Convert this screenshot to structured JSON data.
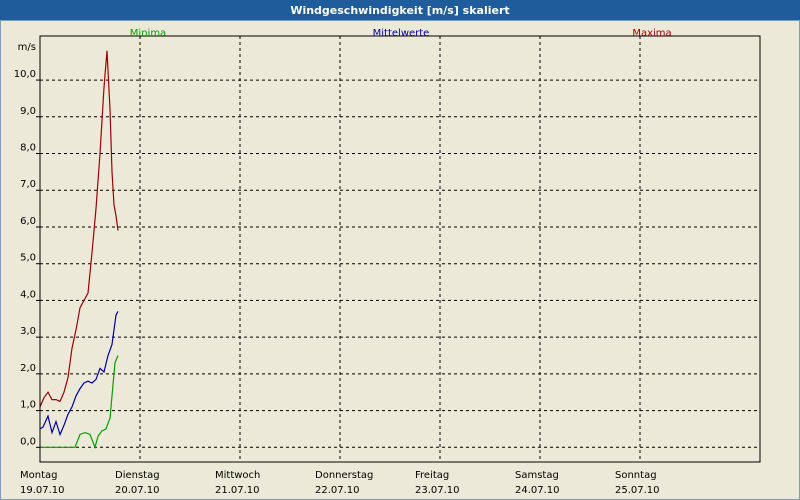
{
  "window": {
    "title": "Windgeschwindigkeit [m/s] skaliert"
  },
  "colors": {
    "minima": "#00A000",
    "mittelwerte": "#0000A0",
    "maxima": "#A00000",
    "titlebar": "#1F5C9C"
  },
  "chart_data": {
    "type": "line",
    "ylabel": "m/s",
    "ylim": [
      -0.4,
      11.2
    ],
    "yticks": [
      "0,0",
      "1,0",
      "2,0",
      "3,0",
      "4,0",
      "5,0",
      "6,0",
      "7,0",
      "8,0",
      "9,0",
      "10,0"
    ],
    "yticks_values": [
      0,
      1,
      2,
      3,
      4,
      5,
      6,
      7,
      8,
      9,
      10
    ],
    "xlim": [
      0,
      7.2
    ],
    "xticks": [
      {
        "day": "Montag",
        "date": "19.07.10"
      },
      {
        "day": "Dienstag",
        "date": "20.07.10"
      },
      {
        "day": "Mittwoch",
        "date": "21.07.10"
      },
      {
        "day": "Donnerstag",
        "date": "22.07.10"
      },
      {
        "day": "Freitag",
        "date": "23.07.10"
      },
      {
        "day": "Samstag",
        "date": "24.07.10"
      },
      {
        "day": "Sonntag",
        "date": "25.07.10"
      }
    ],
    "grid": true,
    "series": [
      {
        "name": "Minima",
        "color": "#00A000",
        "x": [
          0,
          0.05,
          0.1,
          0.15,
          0.2,
          0.25,
          0.3,
          0.35,
          0.4,
          0.45,
          0.5,
          0.55,
          0.58,
          0.62,
          0.66,
          0.7,
          0.75,
          0.78
        ],
        "y": [
          0.0,
          0.0,
          0.0,
          0.0,
          0.0,
          0.0,
          0.0,
          0.0,
          0.35,
          0.4,
          0.35,
          0.0,
          0.3,
          0.45,
          0.5,
          0.8,
          2.3,
          2.5
        ]
      },
      {
        "name": "Mittelwerte",
        "color": "#0000A0",
        "x": [
          0,
          0.03,
          0.08,
          0.12,
          0.16,
          0.2,
          0.24,
          0.28,
          0.32,
          0.36,
          0.4,
          0.44,
          0.48,
          0.52,
          0.56,
          0.6,
          0.64,
          0.68,
          0.72,
          0.76,
          0.78
        ],
        "y": [
          0.5,
          0.55,
          0.85,
          0.4,
          0.7,
          0.35,
          0.6,
          0.9,
          1.1,
          1.4,
          1.6,
          1.75,
          1.8,
          1.75,
          1.85,
          2.15,
          2.05,
          2.5,
          2.8,
          3.6,
          3.7
        ]
      },
      {
        "name": "Maxima",
        "color": "#A00000",
        "x": [
          0,
          0.04,
          0.08,
          0.12,
          0.16,
          0.2,
          0.24,
          0.28,
          0.32,
          0.36,
          0.4,
          0.44,
          0.48,
          0.52,
          0.56,
          0.6,
          0.64,
          0.67,
          0.7,
          0.72,
          0.74,
          0.76,
          0.78
        ],
        "y": [
          1.1,
          1.35,
          1.5,
          1.3,
          1.3,
          1.25,
          1.5,
          1.9,
          2.7,
          3.2,
          3.8,
          4.0,
          4.2,
          5.3,
          6.5,
          8.0,
          9.8,
          10.8,
          9.2,
          7.5,
          6.6,
          6.3,
          5.9
        ]
      }
    ]
  }
}
